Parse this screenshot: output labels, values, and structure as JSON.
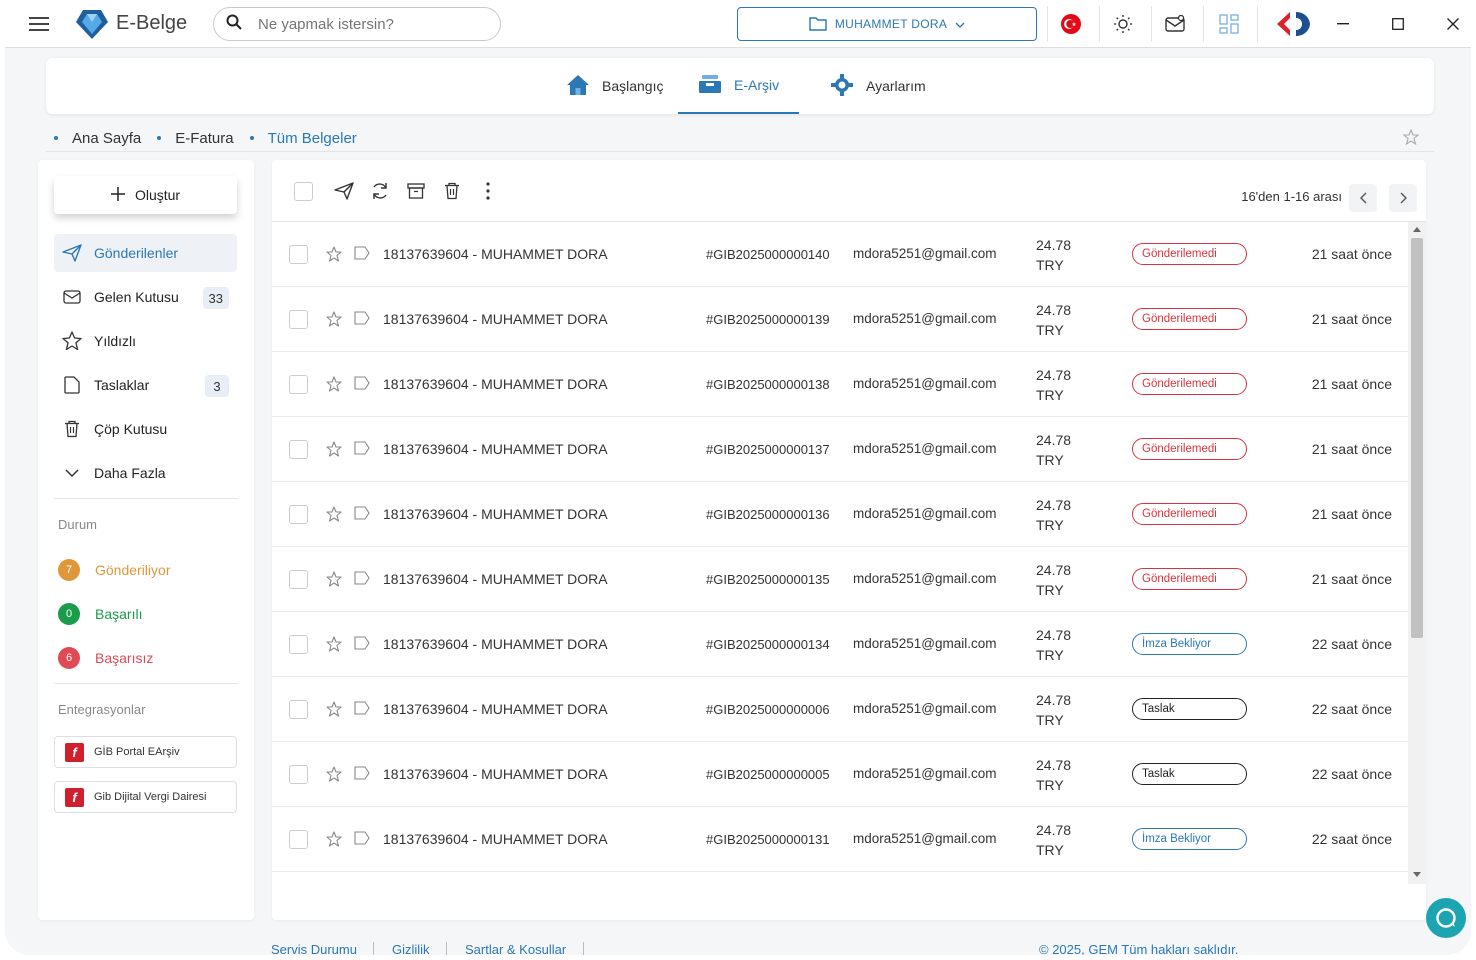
{
  "app": {
    "name": "E-Belge"
  },
  "search": {
    "placeholder": "Ne yapmak istersin?"
  },
  "user": {
    "name": "MUHAMMET DORA"
  },
  "nav": {
    "tabs": [
      {
        "label": "Başlangıç"
      },
      {
        "label": "E-Arşiv"
      },
      {
        "label": "Ayarlarım"
      }
    ]
  },
  "breadcrumb": [
    "Ana Sayfa",
    "E-Fatura",
    "Tüm Belgeler"
  ],
  "sidebar": {
    "create_label": "Oluştur",
    "items": [
      {
        "label": "Gönderilenler",
        "badge": ""
      },
      {
        "label": "Gelen Kutusu",
        "badge": "33"
      },
      {
        "label": "Yıldızlı",
        "badge": ""
      },
      {
        "label": "Taslaklar",
        "badge": "3"
      },
      {
        "label": "Çöp Kutusu",
        "badge": ""
      },
      {
        "label": "Daha Fazla",
        "badge": ""
      }
    ],
    "status_title": "Durum",
    "statuses": [
      {
        "count": "7",
        "label": "Gönderiliyor",
        "color": "#e0973a"
      },
      {
        "count": "0",
        "label": "Başarılı",
        "color": "#1a9c4a"
      },
      {
        "count": "6",
        "label": "Başarısız",
        "color": "#e04a55"
      }
    ],
    "integrations_title": "Entegrasyonlar",
    "integrations": [
      {
        "label": "GİB Portal EArşiv"
      },
      {
        "label": "Gib Dijital Vergi Dairesi"
      }
    ]
  },
  "list": {
    "pager": "16'den 1-16 arası",
    "rows": [
      {
        "name": "18137639604 - MUHAMMET DORA",
        "id": "#GIB2025000000140",
        "email": "mdora5251@gmail.com",
        "amount": "24.78",
        "currency": "TRY",
        "status": "Gönderilemedi",
        "status_type": "fail",
        "time": "21 saat önce"
      },
      {
        "name": "18137639604 - MUHAMMET DORA",
        "id": "#GIB2025000000139",
        "email": "mdora5251@gmail.com",
        "amount": "24.78",
        "currency": "TRY",
        "status": "Gönderilemedi",
        "status_type": "fail",
        "time": "21 saat önce"
      },
      {
        "name": "18137639604 - MUHAMMET DORA",
        "id": "#GIB2025000000138",
        "email": "mdora5251@gmail.com",
        "amount": "24.78",
        "currency": "TRY",
        "status": "Gönderilemedi",
        "status_type": "fail",
        "time": "21 saat önce"
      },
      {
        "name": "18137639604 - MUHAMMET DORA",
        "id": "#GIB2025000000137",
        "email": "mdora5251@gmail.com",
        "amount": "24.78",
        "currency": "TRY",
        "status": "Gönderilemedi",
        "status_type": "fail",
        "time": "21 saat önce"
      },
      {
        "name": "18137639604 - MUHAMMET DORA",
        "id": "#GIB2025000000136",
        "email": "mdora5251@gmail.com",
        "amount": "24.78",
        "currency": "TRY",
        "status": "Gönderilemedi",
        "status_type": "fail",
        "time": "21 saat önce"
      },
      {
        "name": "18137639604 - MUHAMMET DORA",
        "id": "#GIB2025000000135",
        "email": "mdora5251@gmail.com",
        "amount": "24.78",
        "currency": "TRY",
        "status": "Gönderilemedi",
        "status_type": "fail",
        "time": "21 saat önce"
      },
      {
        "name": "18137639604 - MUHAMMET DORA",
        "id": "#GIB2025000000134",
        "email": "mdora5251@gmail.com",
        "amount": "24.78",
        "currency": "TRY",
        "status": "İmza Bekliyor",
        "status_type": "sign",
        "time": "22 saat önce"
      },
      {
        "name": "18137639604 - MUHAMMET DORA",
        "id": "#GIB2025000000006",
        "email": "mdora5251@gmail.com",
        "amount": "24.78",
        "currency": "TRY",
        "status": "Taslak",
        "status_type": "draft",
        "time": "22 saat önce"
      },
      {
        "name": "18137639604 - MUHAMMET DORA",
        "id": "#GIB2025000000005",
        "email": "mdora5251@gmail.com",
        "amount": "24.78",
        "currency": "TRY",
        "status": "Taslak",
        "status_type": "draft",
        "time": "22 saat önce"
      },
      {
        "name": "18137639604 - MUHAMMET DORA",
        "id": "#GIB2025000000131",
        "email": "mdora5251@gmail.com",
        "amount": "24.78",
        "currency": "TRY",
        "status": "İmza Bekliyor",
        "status_type": "sign",
        "time": "22 saat önce"
      }
    ]
  },
  "footer": {
    "links": [
      "Servis Durumu",
      "Gizlilik",
      "Sartlar & Kosullar"
    ],
    "copyright": "© 2025, GEM Tüm hakları saklıdır."
  },
  "colors": {
    "accent": "#2b78b5",
    "fail": "#d9333f",
    "chat": "#1ca5b0"
  },
  "icons": [
    "menu-icon",
    "diamond-logo-icon",
    "search-icon",
    "folder-icon",
    "chevron-down-icon",
    "turkish-flag-icon",
    "sun-icon",
    "mail-icon",
    "layout-icon",
    "carrefour-logo-icon",
    "minimize-icon",
    "maximize-icon",
    "close-icon",
    "home-icon",
    "archive-tray-icon",
    "gear-icon",
    "star-icon",
    "plus-icon",
    "send-icon",
    "inbox-icon",
    "draft-icon",
    "trash-icon",
    "refresh-icon",
    "more-icon",
    "tag-icon",
    "chat-icon"
  ]
}
